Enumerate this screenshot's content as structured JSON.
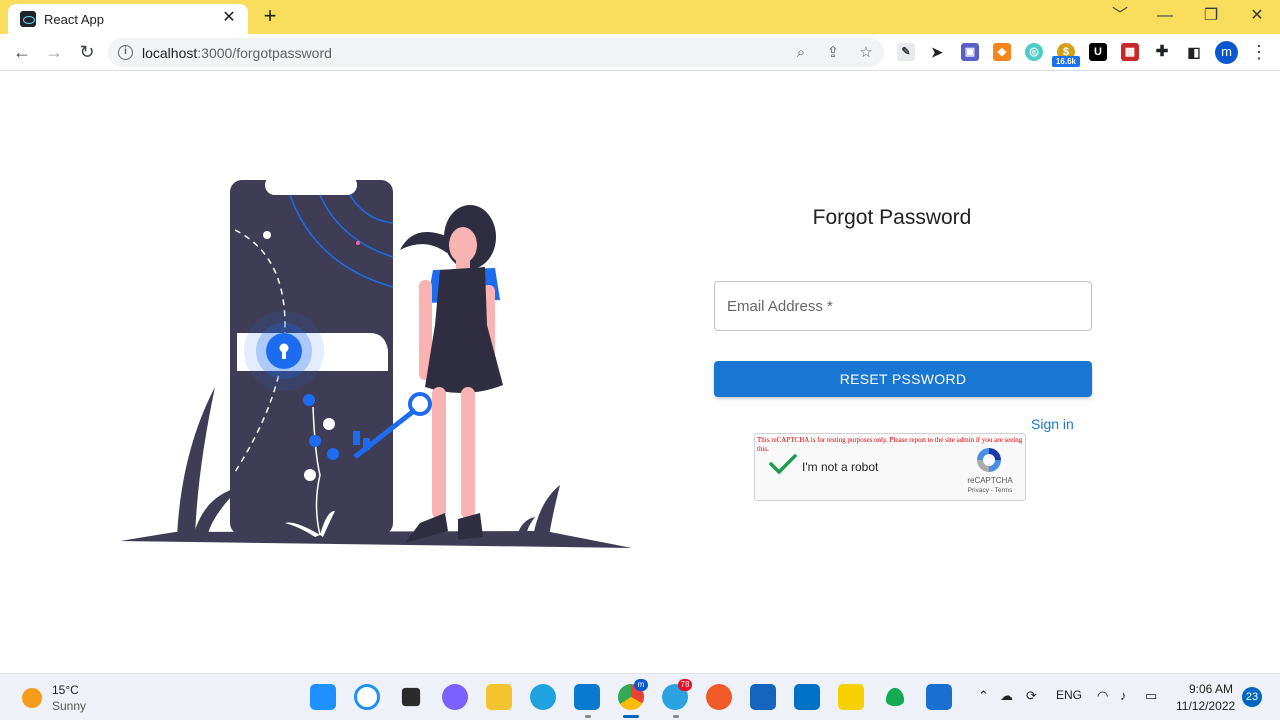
{
  "browser": {
    "tab_title": "React App",
    "tab_close": "✕",
    "new_tab": "+",
    "window_controls": [
      "﹀",
      "—",
      "❐",
      "✕"
    ],
    "url_host": "localhost",
    "url_rest": ":3000/forgotpassword",
    "extension_badge": "16.6k",
    "ext_u": "U",
    "profile_initial": "m"
  },
  "page": {
    "title": "Forgot Password",
    "email_label": "Email Address *",
    "reset_button": "RESET PSSWORD",
    "signin_link": "Sign in"
  },
  "recaptcha": {
    "warning": "This reCAPTCHA is for testing purposes only. Please report to the site admin if you are seeing this.",
    "label": "I'm not a robot",
    "brand": "reCAPTCHA",
    "terms": "Privacy - Terms"
  },
  "taskbar": {
    "temperature": "15°C",
    "weather": "Sunny",
    "telegram_badge": "78",
    "chrome_badge": "m",
    "language": "ENG",
    "time": "9:06 AM",
    "date": "11/12/2022",
    "notification_count": "23"
  },
  "colors": {
    "tabbar": "#f9dd5d",
    "primary": "#1976d2",
    "illustration_dark": "#3f3d56",
    "illustration_blue": "#1d6cf0",
    "skin": "#f9b3b3"
  }
}
